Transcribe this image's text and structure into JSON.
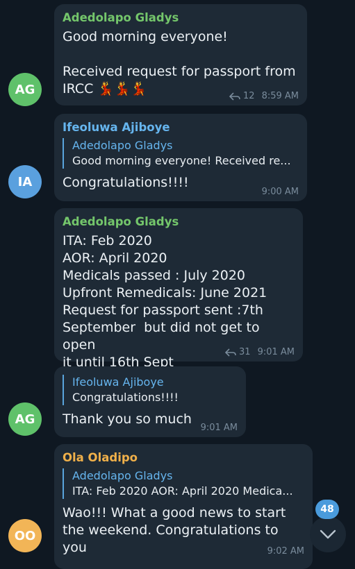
{
  "colors": {
    "background": "#0f1822",
    "bubble": "#1e2a36",
    "green_name": "#74c66b",
    "blue_name": "#66b5ee",
    "orange_name": "#f0b04a",
    "avatar_green": "#5fc16a",
    "avatar_blue": "#5aa0de",
    "avatar_orange": "#f2b557",
    "badge": "#4a9bdc"
  },
  "messages": [
    {
      "sender": "Adedolapo Gladys",
      "avatar": "AG",
      "text": "Good morning everyone!\n\nReceived request for passport from\nIRCC 💃💃💃",
      "forwards": "12",
      "time": "8:59 AM"
    },
    {
      "sender": "Ifeoluwa Ajiboye",
      "avatar": "IA",
      "reply_name": "Adedolapo Gladys",
      "reply_text": "Good morning everyone!  Received re...",
      "text": "Congratulations!!!!",
      "time": "9:00 AM"
    },
    {
      "sender": "Adedolapo Gladys",
      "text": "ITA: Feb 2020\nAOR: April 2020\nMedicals passed : July 2020\nUpfront Remedicals: June 2021\nRequest for passport sent :7th\nSeptember  but did not get to open\nit until 16th Sept",
      "forwards": "31",
      "time": "9:01 AM"
    },
    {
      "avatar": "AG",
      "reply_name": "Ifeoluwa Ajiboye",
      "reply_text": "Congratulations!!!!",
      "text": "Thank you so much",
      "time": "9:01 AM"
    },
    {
      "sender": "Ola Oladipo",
      "avatar": "OO",
      "reply_name": "Adedolapo Gladys",
      "reply_text": "ITA: Feb 2020 AOR: April 2020 Medica...",
      "text": "Wao!!! What a good news to start\nthe weekend. Congratulations to\nyou",
      "time": "9:02 AM"
    }
  ],
  "scroll_down": {
    "unread_count": "48",
    "icon": "chevron-down-icon"
  }
}
